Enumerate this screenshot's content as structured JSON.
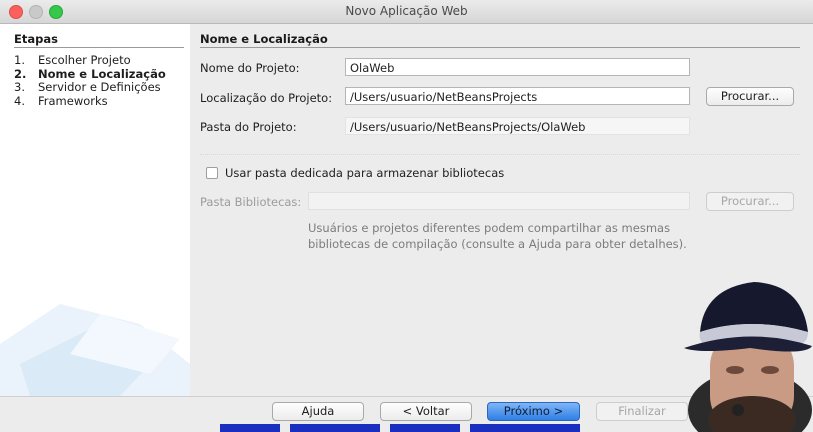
{
  "window": {
    "title": "Novo Aplicação Web"
  },
  "steps": {
    "title": "Etapas",
    "items": [
      {
        "num": "1.",
        "label": "Escolher Projeto",
        "active": false
      },
      {
        "num": "2.",
        "label": "Nome e Localização",
        "active": true
      },
      {
        "num": "3.",
        "label": "Servidor e Definições",
        "active": false
      },
      {
        "num": "4.",
        "label": "Frameworks",
        "active": false
      }
    ]
  },
  "form": {
    "section_title": "Nome e Localização",
    "project_name_label": "Nome do Projeto:",
    "project_name_value": "OlaWeb",
    "location_label": "Localização do Projeto:",
    "location_value": "/Users/usuario/NetBeansProjects",
    "browse_label": "Procurar...",
    "folder_label": "Pasta do Projeto:",
    "folder_value": "/Users/usuario/NetBeansProjects/OlaWeb",
    "dedicated_folder_label": "Usar pasta dedicada para armazenar bibliotecas",
    "libraries_label": "Pasta Bibliotecas:",
    "libraries_value": "",
    "libraries_browse_label": "Procurar...",
    "help_text": "Usuários e projetos diferentes podem compartilhar as mesmas bibliotecas de compilação (consulte a Ajuda para obter detalhes)."
  },
  "footer": {
    "help_label": "Ajuda",
    "back_label": "< Voltar",
    "next_label": "Próximo >",
    "finish_label": "Finalizar"
  },
  "colors": {
    "primary_button": "#2f7fe5",
    "window_close": "#fc605c",
    "window_zoom": "#35c84a"
  }
}
